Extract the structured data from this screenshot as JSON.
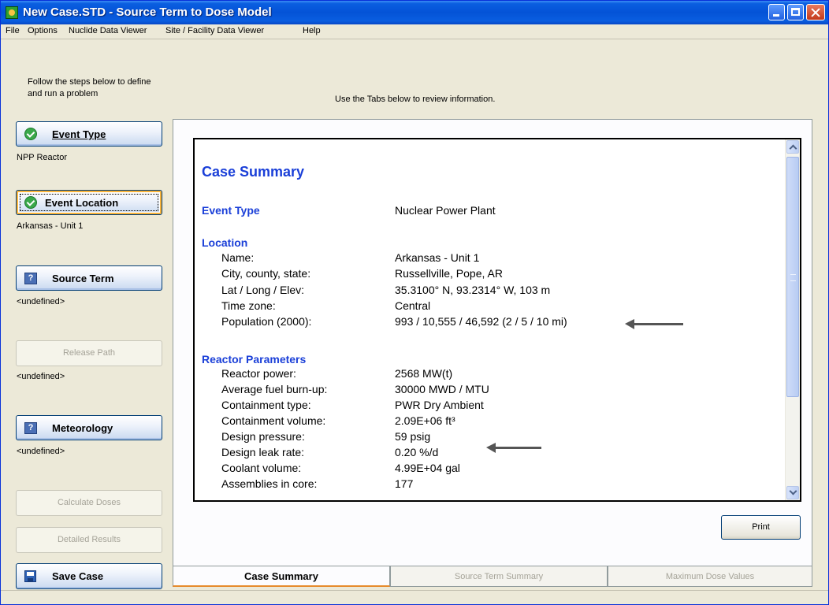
{
  "window": {
    "title": "New Case.STD - Source Term to Dose Model"
  },
  "menu": [
    "File",
    "Options",
    "Nuclide Data Viewer",
    "Site / Facility Data Viewer",
    "Help"
  ],
  "left": {
    "hint": "Follow the steps below to define and run a problem",
    "steps": {
      "event_type": {
        "label": "Event Type",
        "value": "NPP Reactor"
      },
      "event_location": {
        "label": "Event Location",
        "value": "Arkansas - Unit 1"
      },
      "source_term": {
        "label": "Source Term",
        "value": "<undefined>"
      },
      "release_path": {
        "label": "Release Path",
        "value": "<undefined>"
      },
      "meteorology": {
        "label": "Meteorology",
        "value": "<undefined>"
      }
    },
    "calculate_doses": "Calculate Doses",
    "detailed_results": "Detailed Results",
    "save_case": "Save Case"
  },
  "main": {
    "hint": "Use the Tabs below to review information.",
    "doc": {
      "title": "Case Summary",
      "event_type_label": "Event Type",
      "event_type_value": "Nuclear Power Plant",
      "location_heading": "Location",
      "location": [
        {
          "label": "Name:",
          "value": "Arkansas - Unit 1"
        },
        {
          "label": "City, county, state:",
          "value": "Russellville, Pope, AR"
        },
        {
          "label": "Lat / Long / Elev:",
          "value": "35.3100° N, 93.2314° W, 103 m"
        },
        {
          "label": "Time zone:",
          "value": "Central"
        },
        {
          "label": "Population (2000):",
          "value": "993 / 10,555 / 46,592 (2 / 5 / 10 mi)"
        }
      ],
      "reactor_heading": "Reactor Parameters",
      "reactor": [
        {
          "label": "Reactor power:",
          "value": "2568 MW(t)"
        },
        {
          "label": "Average fuel burn-up:",
          "value": "30000 MWD / MTU"
        },
        {
          "label": "Containment type:",
          "value": "PWR Dry Ambient"
        },
        {
          "label": "Containment volume:",
          "value": "2.09E+06 ft³"
        },
        {
          "label": "Design pressure:",
          "value": "59 psig"
        },
        {
          "label": "Design leak rate:",
          "value": "0.20 %/d"
        },
        {
          "label": "Coolant volume:",
          "value": "4.99E+04 gal"
        },
        {
          "label": "Assemblies in core:",
          "value": "177"
        }
      ]
    },
    "print": "Print",
    "tabs": [
      "Case Summary",
      "Source Term Summary",
      "Maximum Dose Values"
    ]
  },
  "colors": {
    "heading": "#1a3fd8",
    "titlebar": "#0453d7",
    "active_tab_accent": "#e68b2c"
  }
}
